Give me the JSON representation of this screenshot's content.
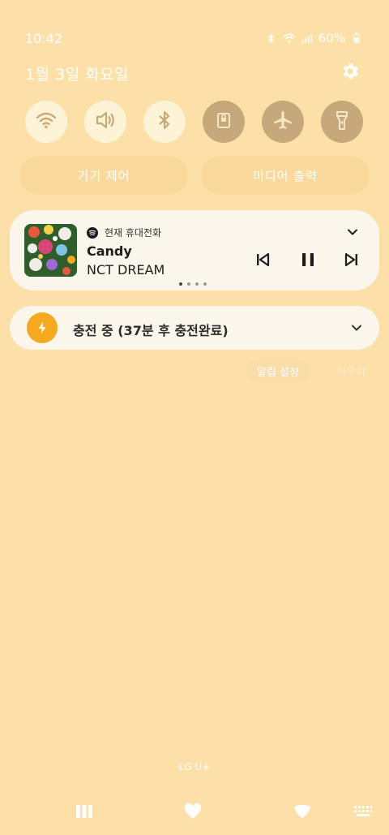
{
  "status_bar": {
    "time": "10:42",
    "battery": "60%",
    "icons": [
      "bluetooth-icon",
      "wifi-icon",
      "signal-icon",
      "battery-icon"
    ]
  },
  "date": "1월 3일 화요일",
  "quick_settings": [
    {
      "name": "wifi",
      "icon": "wifi-icon",
      "state": "on"
    },
    {
      "name": "sound",
      "icon": "volume-icon",
      "state": "on"
    },
    {
      "name": "bluetooth",
      "icon": "bluetooth-icon",
      "state": "on"
    },
    {
      "name": "screen-lock",
      "icon": "lock-icon",
      "state": "off"
    },
    {
      "name": "airplane",
      "icon": "airplane-icon",
      "state": "off"
    },
    {
      "name": "flashlight",
      "icon": "flashlight-icon",
      "state": "off"
    }
  ],
  "pills": {
    "device_control": "기기 제어",
    "media_output": "미디어 출력"
  },
  "media": {
    "app_label": "현재 휴대전화",
    "song": "Candy",
    "artist": "NCT DREAM",
    "page_dots": 4,
    "active_dot": 0
  },
  "charging": {
    "text": "충전 중 (37분 후 충전완료)"
  },
  "notification_actions": {
    "settings": "알림 설정",
    "clear": "지우기"
  },
  "carrier": "LG U+",
  "colors": {
    "background": "#FCE0A8",
    "tile_on": "#FDF4D8",
    "tile_off": "#C7A87B",
    "charge_accent": "#F4A91E"
  }
}
